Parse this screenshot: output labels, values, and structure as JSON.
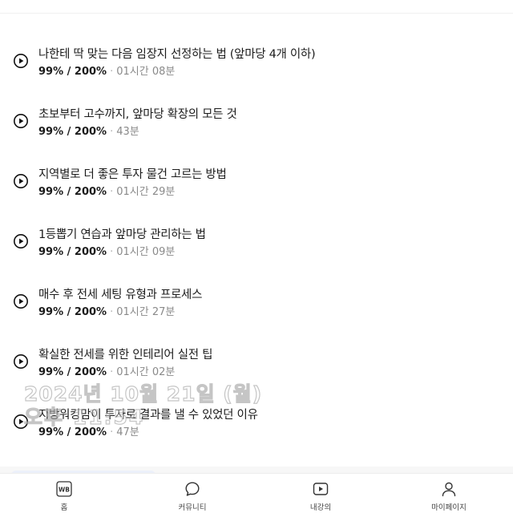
{
  "lessons": [
    {
      "title": "나한테 딱 맞는 다음 임장지 선정하는 법 (앞마당 4개 이하)",
      "progress": "99% / 200%",
      "duration": "01시간 08분"
    },
    {
      "title": "초보부터 고수까지, 앞마당 확장의 모든 것",
      "progress": "99% / 200%",
      "duration": "43분"
    },
    {
      "title": "지역별로 더 좋은 투자 물건 고르는 방법",
      "progress": "99% / 200%",
      "duration": "01시간 29분"
    },
    {
      "title": "1등뽑기 연습과 앞마당 관리하는 법",
      "progress": "99% / 200%",
      "duration": "01시간 09분"
    },
    {
      "title": "매수 후 전세 세팅 유형과 프로세스",
      "progress": "99% / 200%",
      "duration": "01시간 27분"
    },
    {
      "title": "확실한 전세를 위한 인테리어 실전 팁",
      "progress": "99% / 200%",
      "duration": "01시간 02분"
    },
    {
      "title": "지방워킹맘이 투자로 결과를 낼 수 있었던 이유",
      "progress": "99% / 200%",
      "duration": "47분"
    }
  ],
  "separator": "·",
  "watermark": {
    "line1": "2024년 10월 21일 (월)",
    "line2": "오후 11:54"
  },
  "tabbar": {
    "home": "홈",
    "community": "커뮤니티",
    "my_lectures": "내강의",
    "my_page": "마이페이지",
    "home_logo": "WB"
  },
  "icons": [
    "play-circle-icon",
    "home-wb-icon",
    "chat-bubble-icon",
    "video-play-icon",
    "person-icon"
  ]
}
